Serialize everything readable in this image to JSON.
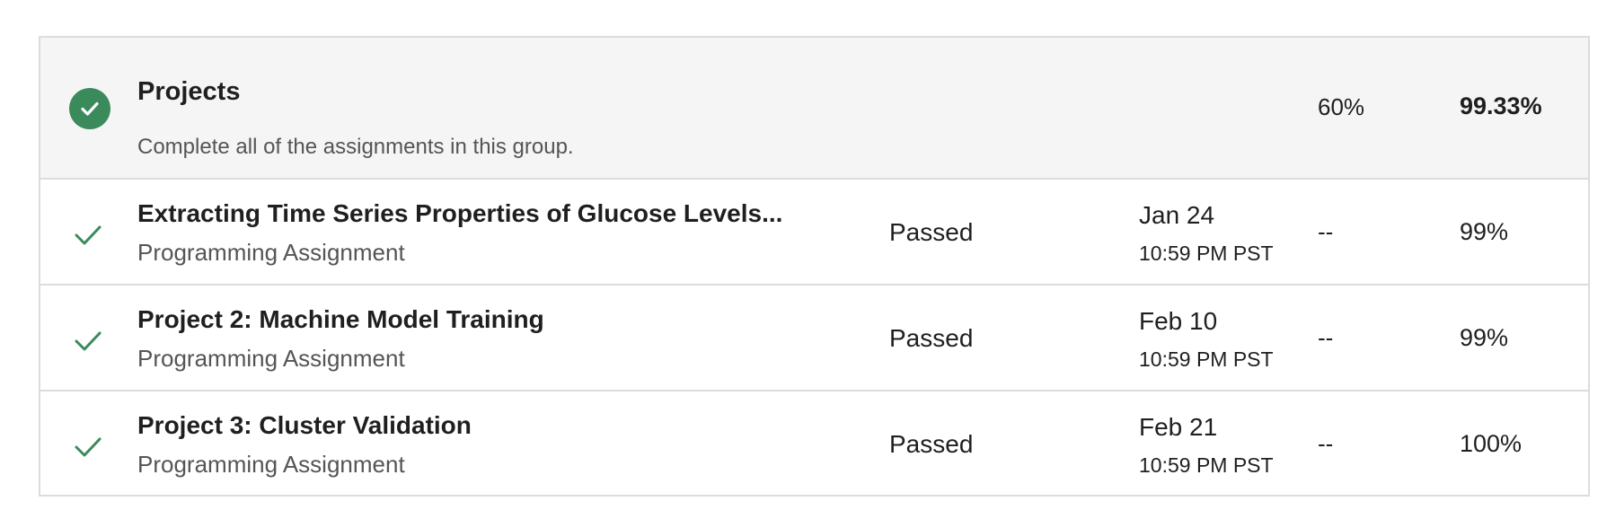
{
  "group": {
    "title": "Projects",
    "description": "Complete all of the assignments in this group.",
    "weight": "60%",
    "grade": "99.33%",
    "status_icon": "check-circle-icon"
  },
  "items": [
    {
      "title": "Extracting Time Series Properties of Glucose Levels...",
      "type": "Programming Assignment",
      "status": "Passed",
      "due_date": "Jan 24",
      "due_time": "10:59 PM PST",
      "weight": "--",
      "grade": "99%",
      "status_icon": "check-icon"
    },
    {
      "title": "Project 2: Machine Model Training",
      "type": "Programming Assignment",
      "status": "Passed",
      "due_date": "Feb 10",
      "due_time": "10:59 PM PST",
      "weight": "--",
      "grade": "99%",
      "status_icon": "check-icon"
    },
    {
      "title": "Project 3: Cluster Validation",
      "type": "Programming Assignment",
      "status": "Passed",
      "due_date": "Feb 21",
      "due_time": "10:59 PM PST",
      "weight": "--",
      "grade": "100%",
      "status_icon": "check-icon"
    }
  ],
  "colors": {
    "success": "#3b8a5c",
    "header_bg": "#f5f5f5",
    "border": "#dcdcdc"
  }
}
